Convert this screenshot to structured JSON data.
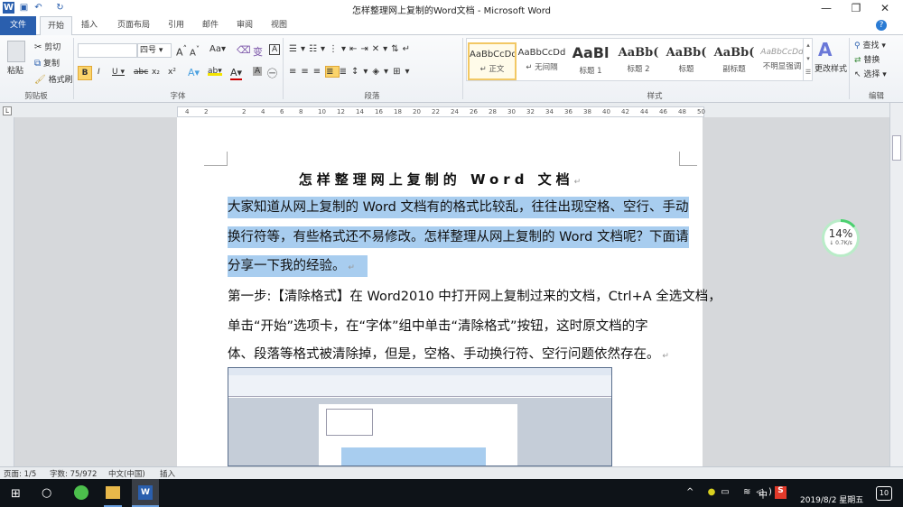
{
  "window": {
    "title": "怎样整理网上复制的Word文档 - Microsoft Word",
    "minimize": "—",
    "restore": "❐",
    "close": "✕"
  },
  "tabs": [
    "文件",
    "开始",
    "插入",
    "页面布局",
    "引用",
    "邮件",
    "审阅",
    "视图"
  ],
  "clipboard": {
    "paste": "粘贴",
    "cut": "剪切",
    "copy": "复制",
    "format_painter": "格式刷",
    "label": "剪贴板"
  },
  "font": {
    "font_name": "",
    "font_size": "四号",
    "label": "字体"
  },
  "paragraph": {
    "label": "段落"
  },
  "styles": {
    "items": [
      {
        "sample": "AaBbCcDd",
        "name": "↵ 正文"
      },
      {
        "sample": "AaBbCcDd",
        "name": "↵ 无间隔"
      },
      {
        "sample": "AaBl",
        "name": "标题 1"
      },
      {
        "sample": "AaBb(",
        "name": "标题 2"
      },
      {
        "sample": "AaBb(",
        "name": "标题"
      },
      {
        "sample": "AaBb(",
        "name": "副标题"
      },
      {
        "sample": "AaBbCcDd",
        "name": "不明显强调"
      }
    ],
    "change": "更改样式",
    "label": "样式"
  },
  "editing": {
    "find": "查找",
    "replace": "替换",
    "select": "选择",
    "label": "编辑"
  },
  "ruler": [
    "4",
    "2",
    "",
    "2",
    "4",
    "6",
    "8",
    "10",
    "12",
    "14",
    "16",
    "18",
    "20",
    "22",
    "24",
    "26",
    "28",
    "30",
    "32",
    "34",
    "36",
    "38",
    "40",
    "42",
    "44",
    "46",
    "48",
    "50"
  ],
  "document": {
    "title": "怎样整理网上复制的 Word 文档",
    "lines": [
      "大家知道从网上复制的 Word 文档有的格式比较乱，往往出现空格、空行、手动",
      "换行符等，有些格式还不易修改。怎样整理从网上复制的 Word 文档呢？下面请",
      "分享一下我的经验。",
      "第一步:【清除格式】在 Word2010 中打开网上复制过来的文档，Ctrl+A 全选文档，",
      "单击“开始”选项卡，在“字体”组中单击“清除格式”按钮，这时原文档的字",
      "体、段落等格式被清除掉，但是，空格、手动换行符、空行问题依然存在。"
    ]
  },
  "speed_widget": {
    "percent": "14%",
    "rate": "↓ 0.7K/s",
    "progress": 0.14
  },
  "statusbar": {
    "page": "页面: 1/5",
    "words": "字数: 75/972",
    "language": "中文(中国)",
    "mode": "插入"
  },
  "taskbar": {
    "date": "2019/8/2 星期五",
    "ime": "中",
    "notif": "10"
  }
}
